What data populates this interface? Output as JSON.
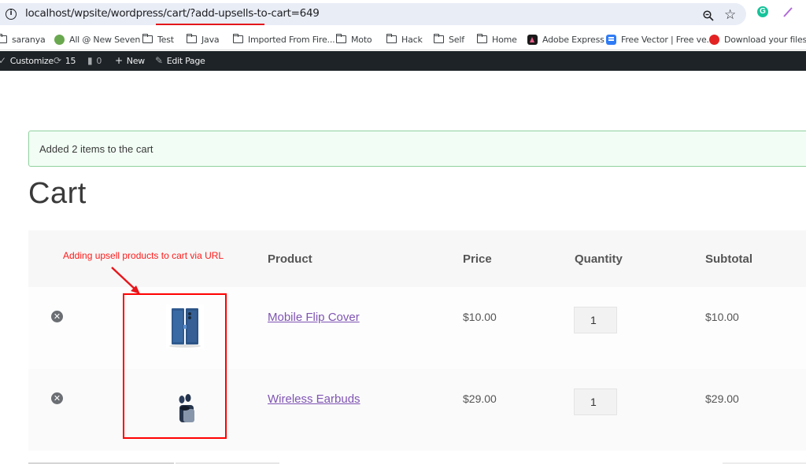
{
  "browser": {
    "url_host": "localhost",
    "url_path": "/wpsite/wordpress/cart/",
    "url_query": "?add-upsells-to-cart=649",
    "bookmarks": [
      {
        "label": "saranya",
        "icon": "folder-icon"
      },
      {
        "label": "All @ New Seven",
        "icon": "new-seven-favicon"
      },
      {
        "label": "Test",
        "icon": "folder-icon"
      },
      {
        "label": "Java",
        "icon": "folder-icon"
      },
      {
        "label": "Imported From Fire...",
        "icon": "folder-icon"
      },
      {
        "label": "Moto",
        "icon": "folder-icon"
      },
      {
        "label": "Hack",
        "icon": "folder-icon"
      },
      {
        "label": "Self",
        "icon": "folder-icon"
      },
      {
        "label": "Home",
        "icon": "folder-icon"
      },
      {
        "label": "Adobe Express",
        "icon": "adobe-express-favicon"
      },
      {
        "label": "Free Vector | Free ve...",
        "icon": "free-vector-favicon"
      },
      {
        "label": "Download your files...",
        "icon": "download-favicon"
      }
    ],
    "extension_icons": [
      "zoom-out-icon",
      "bookmark-star-icon",
      "grammarly-icon",
      "pen-extension-icon"
    ]
  },
  "admin_bar": {
    "customize": "Customize",
    "updates_count": "15",
    "comments_count": "0",
    "new": "New",
    "edit_page": "Edit Page"
  },
  "notice": {
    "message": "Added 2 items to the cart",
    "accent_color": "#8fd19e"
  },
  "page": {
    "title": "Cart"
  },
  "cart": {
    "columns": [
      "Product",
      "Price",
      "Quantity",
      "Subtotal"
    ],
    "items": [
      {
        "name": "Mobile Flip Cover",
        "price": "$10.00",
        "quantity": "1",
        "subtotal": "$10.00",
        "thumbnail": "flip-cover-image"
      },
      {
        "name": "Wireless Earbuds",
        "price": "$29.00",
        "quantity": "1",
        "subtotal": "$29.00",
        "thumbnail": "earbuds-image"
      }
    ],
    "link_color": "#7f54b3"
  },
  "annotation": {
    "label": "Adding upsell products to cart via URL",
    "color": "#ff0000"
  }
}
